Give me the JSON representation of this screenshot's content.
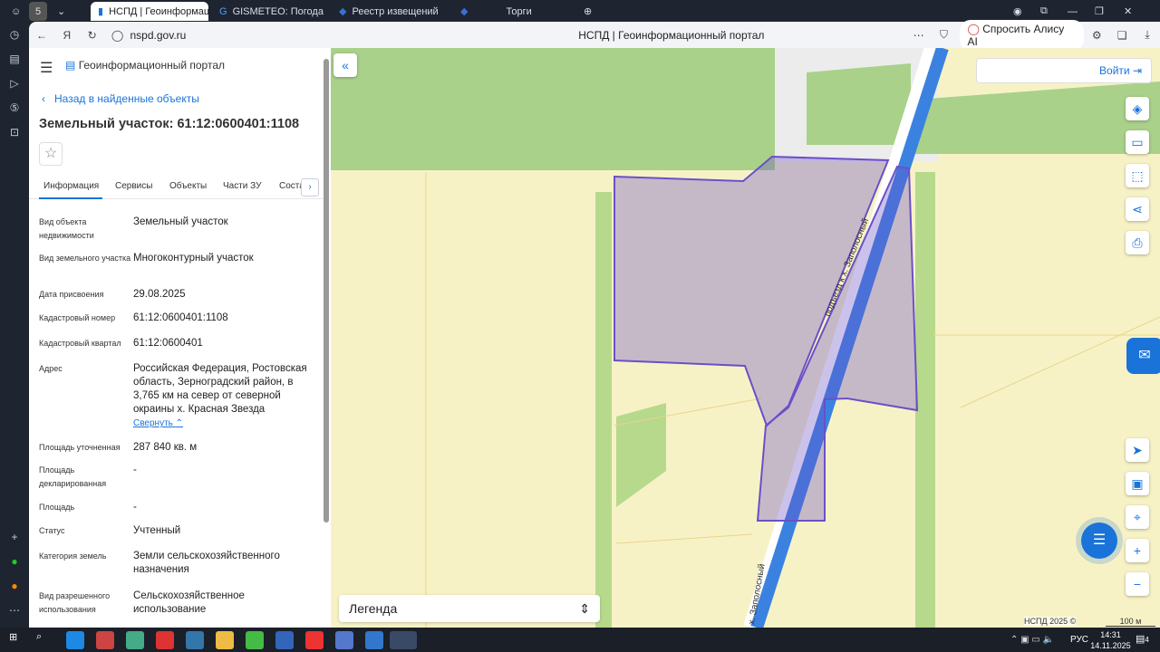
{
  "browser": {
    "tabs": [
      {
        "label": "НСПД | Геоинформаци",
        "active": true
      },
      {
        "label": "GISMETEO: Погода в Зер"
      },
      {
        "label": "Реестр извещений"
      },
      {
        "label": "Торги"
      }
    ],
    "url": "nspd.gov.ru",
    "page_title": "НСПД | Геоинформационный портал",
    "alice": "Спросить Алису AI"
  },
  "panel": {
    "portal_title": "Геоинформационный портал",
    "back": "Назад в найденные объекты",
    "title": "Земельный участок: 61:12:0600401:1108",
    "tabs": [
      "Информация",
      "Сервисы",
      "Объекты",
      "Части ЗУ",
      "Соста"
    ],
    "fields": [
      {
        "label": "Вид объекта недвижимости",
        "value": "Земельный участок"
      },
      {
        "label": "Вид земельного участка",
        "value": "Многоконтурный участок"
      },
      {
        "label": "Дата присвоения",
        "value": "29.08.2025"
      },
      {
        "label": "Кадастровый номер",
        "value": "61:12:0600401:1108"
      },
      {
        "label": "Кадастровый квартал",
        "value": "61:12:0600401"
      },
      {
        "label": "Адрес",
        "value": "Российская Федерация, Ростовская область, Зерноградский район, в 3,765 км на север от северной окраины х. Красная Звезда"
      },
      {
        "label": "Площадь уточненная",
        "value": "287 840 кв. м"
      },
      {
        "label": "Площадь декларированная",
        "value": "-"
      },
      {
        "label": "Площадь",
        "value": "-"
      },
      {
        "label": "Статус",
        "value": "Учтенный"
      },
      {
        "label": "Категория земель",
        "value": "Земли сельскохозяйственного назначения"
      },
      {
        "label": "Вид разрешенного использования",
        "value": "Сельскохозяйственное использование"
      }
    ],
    "collapse": "Свернуть"
  },
  "map": {
    "login": "Войти",
    "legend": "Легенда",
    "road_labels": [
      "подъезд к х. Заполосный",
      "х. Заполосный"
    ],
    "attribution": "НСПД 2025 ©",
    "scale": "100 м",
    "parcel_color": "#6a50c8",
    "road_color": "#3b82e0"
  },
  "taskbar": {
    "lang": "РУС",
    "time": "14:31",
    "date": "14.11.2025",
    "notifications": "4"
  }
}
